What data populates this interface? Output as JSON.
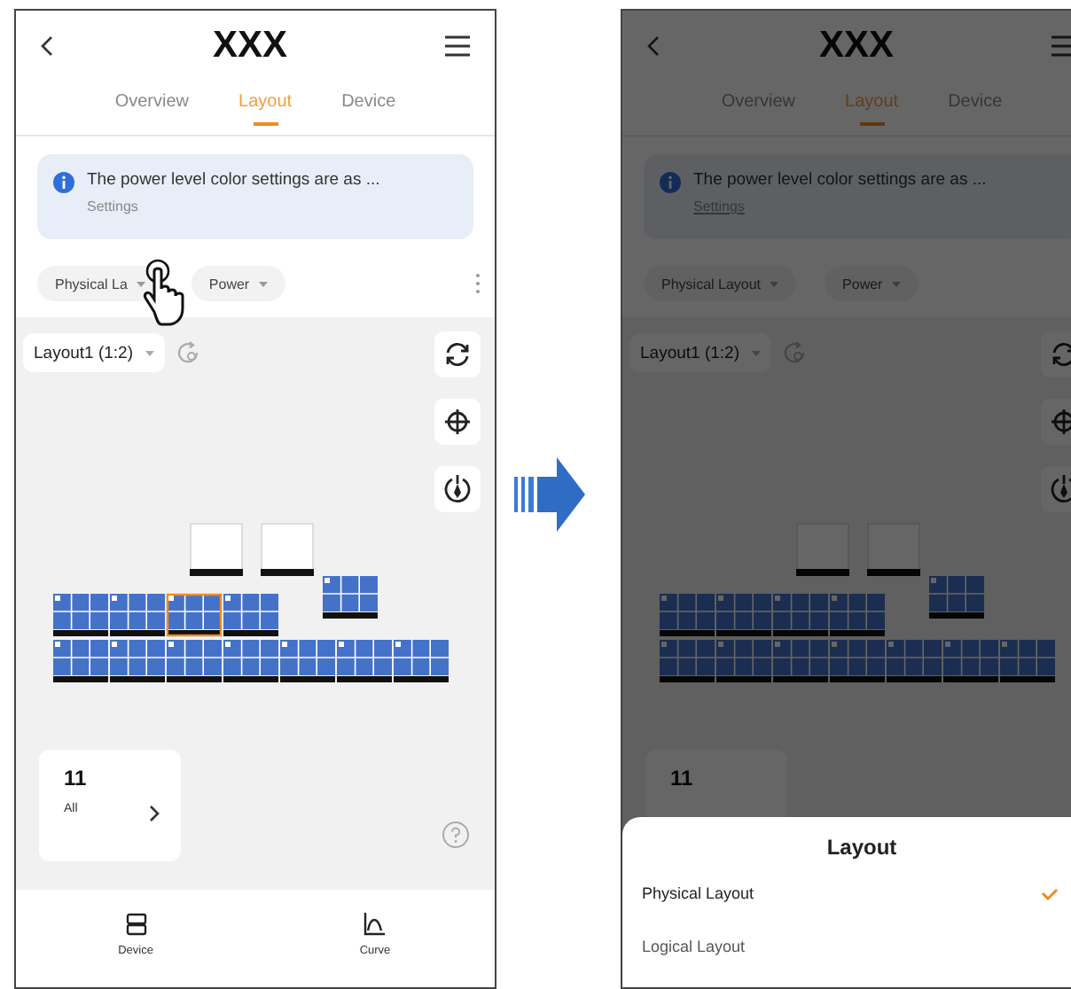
{
  "screens": [
    {
      "dimmed": false,
      "pointer": true,
      "title": "XXX",
      "tabs": [
        {
          "label": "Overview",
          "selected": false
        },
        {
          "label": "Layout",
          "selected": true
        },
        {
          "label": "Device",
          "selected": false
        }
      ],
      "banner": {
        "text": "The power level color settings are as ...",
        "link": "Settings"
      },
      "chips": [
        "Physical La",
        "Power"
      ],
      "layout_select": "Layout1 (1:2)",
      "panel_groups": [
        {
          "selected": false
        },
        {
          "selected": false
        },
        {
          "selected": true
        },
        {
          "selected": false
        },
        {
          "selected": false
        },
        {
          "selected": false
        },
        {
          "selected": false
        },
        {
          "selected": false
        },
        {
          "selected": false
        },
        {
          "selected": false
        },
        {
          "selected": false
        },
        {
          "selected": false
        }
      ],
      "summary": {
        "count": "11",
        "label": "All"
      },
      "bottom_nav": [
        {
          "kind": "device",
          "label": "Device"
        },
        {
          "kind": "curve",
          "label": "Curve"
        }
      ]
    },
    {
      "dimmed": true,
      "pointer": false,
      "title": "XXX",
      "tabs": [
        {
          "label": "Overview",
          "selected": false
        },
        {
          "label": "Layout",
          "selected": true
        },
        {
          "label": "Device",
          "selected": false
        }
      ],
      "banner": {
        "text": "The power level color settings are as ...",
        "link": "Settings"
      },
      "chips": [
        "Physical Layout",
        "Power"
      ],
      "layout_select": "Layout1 (1:2)",
      "panel_groups": [
        {
          "selected": false
        },
        {
          "selected": false
        },
        {
          "selected": false
        },
        {
          "selected": false
        },
        {
          "selected": false
        },
        {
          "selected": false
        },
        {
          "selected": false
        },
        {
          "selected": false
        },
        {
          "selected": false
        },
        {
          "selected": false
        },
        {
          "selected": false
        },
        {
          "selected": false
        }
      ],
      "summary": {
        "count": "11"
      },
      "sheet": {
        "title": "Layout",
        "options": [
          {
            "label": "Physical Layout",
            "selected": true
          },
          {
            "label": "Logical Layout",
            "selected": false
          }
        ]
      }
    }
  ]
}
